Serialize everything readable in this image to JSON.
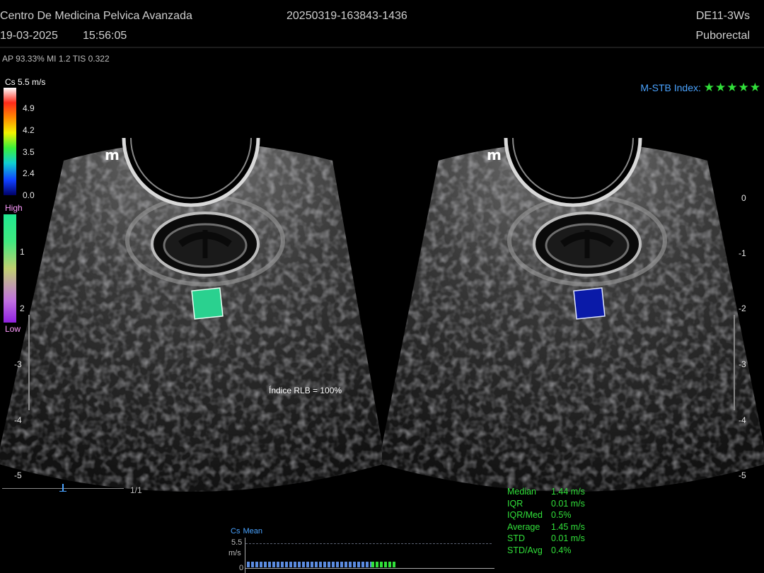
{
  "header": {
    "clinic": "Centro De Medicina Pelvica Avanzada",
    "exam_id": "20250319-163843-1436",
    "probe": "DE11-3Ws",
    "date": "19-03-2025",
    "time": "15:56:05",
    "preset": "Puborectal",
    "params": "AP 93.33%  MI 1.2 TIS 0.322"
  },
  "colorbar": {
    "title": "Cs 5.5 m/s",
    "ticks": [
      "4.9",
      "4.2",
      "3.5",
      "2.4",
      "0.0"
    ],
    "quality_high": "High",
    "quality_low": "Low"
  },
  "quality_index": {
    "label": "M-STB Index:",
    "stars": "★★★★★",
    "value": 5
  },
  "left_depth_ticks": [
    "1",
    "2",
    "-3",
    "-4",
    "-5"
  ],
  "right_depth_ticks": [
    "0",
    "-1",
    "-2",
    "-3",
    "-4",
    "-5"
  ],
  "probe_marker": "m",
  "rlb_index": "Índice RLB = 100%",
  "frame_counter": "1/1",
  "measurements": [
    {
      "label": "Median",
      "value": "1.44 m/s"
    },
    {
      "label": "IQR",
      "value": "0.01 m/s"
    },
    {
      "label": "IQR/Med",
      "value": "0.5%"
    },
    {
      "label": "Average",
      "value": "1.45 m/s"
    },
    {
      "label": "STD",
      "value": "0.01 m/s"
    },
    {
      "label": "STD/Avg",
      "value": "0.4%"
    }
  ],
  "timeline": {
    "label_cs": "Cs",
    "label_mean": "Mean",
    "max": "5.5",
    "unit": "m/s",
    "zero": "0"
  },
  "colors": {
    "roi_left": "#2ad18f",
    "roi_right": "#0a1aa8",
    "accent_green": "#31e03a",
    "accent_blue": "#4aa3ff"
  }
}
